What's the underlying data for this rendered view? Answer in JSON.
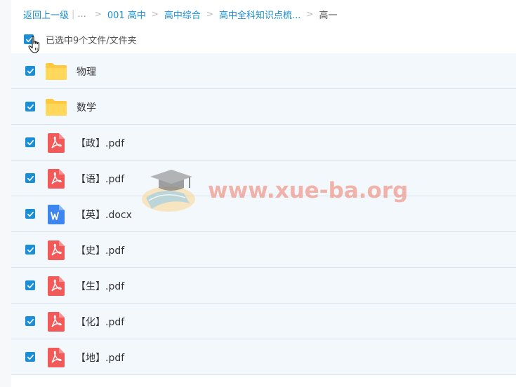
{
  "breadcrumb": {
    "back": "返回上一级",
    "more": "...",
    "items": [
      "001 高中",
      "高中综合",
      "高中全科知识点梳..."
    ],
    "current": "高一",
    "arrow": ">"
  },
  "selection": {
    "label": "已选中9个文件/文件夹"
  },
  "files": [
    {
      "name": "物理",
      "type": "folder"
    },
    {
      "name": "数学",
      "type": "folder"
    },
    {
      "name": "【政】.pdf",
      "type": "pdf"
    },
    {
      "name": "【语】.pdf",
      "type": "pdf"
    },
    {
      "name": "【英】.docx",
      "type": "docx"
    },
    {
      "name": "【史】.pdf",
      "type": "pdf"
    },
    {
      "name": "【生】.pdf",
      "type": "pdf"
    },
    {
      "name": "【化】.pdf",
      "type": "pdf"
    },
    {
      "name": "【地】.pdf",
      "type": "pdf"
    }
  ],
  "watermark": {
    "text": "www.xue-ba.org"
  },
  "icons": {
    "folder": "folder-icon",
    "pdf": "pdf-file-icon",
    "docx": "word-file-icon",
    "checkbox": "checkbox-checked-icon",
    "cursor": "hand-pointer-icon"
  },
  "colors": {
    "accent": "#1a8fd6",
    "row_bg": "#f3f8fd",
    "folder": "#ffd04b",
    "pdf": "#f25a5a",
    "docx": "#3d86f0"
  }
}
